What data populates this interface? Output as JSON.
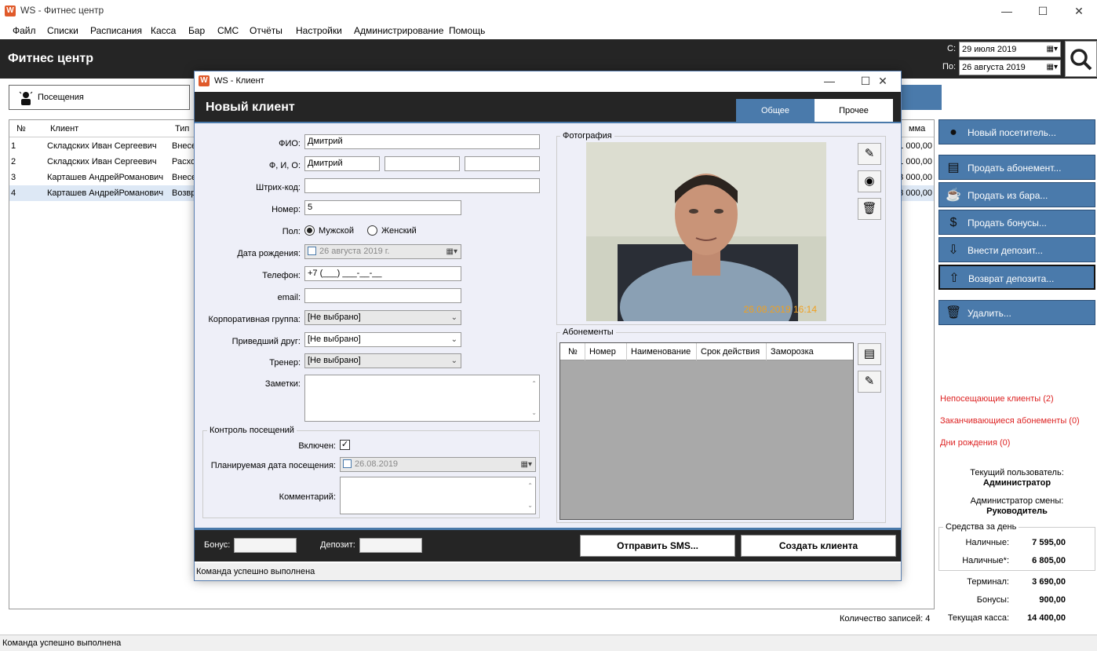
{
  "app": {
    "icon": "W",
    "title": "WS - Фитнес центр",
    "window_controls": {
      "minimize": "—",
      "maximize": "☐",
      "close": "✕"
    }
  },
  "menu": [
    "Файл",
    "Списки",
    "Расписания",
    "Касса",
    "Бар",
    "СМС",
    "Отчёты",
    "Настройки",
    "Администрирование",
    "Помощь"
  ],
  "header": {
    "title": "Фитнес центр",
    "from_label": "С:",
    "from_date": "29    июля      2019",
    "to_label": "По:",
    "to_date": "26  августа    2019"
  },
  "visits_button": "Посещения",
  "table": {
    "headers": [
      "№",
      "Клиент",
      "Тип",
      "мма"
    ],
    "rows": [
      {
        "n": "1",
        "client": "Складских Иван Сергеевич",
        "type": "Внесе",
        "sum": "1 000,00"
      },
      {
        "n": "2",
        "client": "Складских Иван Сергеевич",
        "type": "Расхо",
        "sum": "1 000,00"
      },
      {
        "n": "3",
        "client": "Карташев АндрейРоманович",
        "type": "Внесе",
        "sum": "3 000,00"
      },
      {
        "n": "4",
        "client": "Карташев АндрейРоманович",
        "type": "Возвр",
        "sum": "3 000,00"
      }
    ]
  },
  "right_buttons": [
    "Новый посетитель...",
    "Продать абонемент...",
    "Продать из бара...",
    "Продать бонусы...",
    "Внести депозит...",
    "Возврат депозита...",
    "Удалить..."
  ],
  "links": [
    "Непосещающие клиенты (2)",
    "Заканчивающиеся абонементы (0)",
    "Дни рождения (0)"
  ],
  "user": {
    "current_label": "Текущий пользователь:",
    "current": "Администратор",
    "shift_label": "Администратор смены:",
    "shift": "Руководитель"
  },
  "funds": {
    "title": "Средства за день",
    "cash_label": "Наличные:",
    "cash": "7 595,00",
    "cash2_label": "Наличные*:",
    "cash2": "6 805,00",
    "terminal_label": "Терминал:",
    "terminal": "3 690,00",
    "bonus_label": "Бонусы:",
    "bonus": "900,00",
    "kassa_label": "Текущая касса:",
    "kassa": "14 400,00"
  },
  "records": "Количество записей: 4",
  "status": "Команда успешно выполнена",
  "modal": {
    "title": "WS - Клиент",
    "heading": "Новый клиент",
    "tabs": [
      "Общее",
      "Прочее"
    ],
    "fio_label": "ФИО:",
    "fio": "Дмитрий",
    "fio_parts_label": "Ф, И, О:",
    "surname": "Дмитрий",
    "name": "",
    "patronymic": "",
    "barcode_label": "Штрих-код:",
    "barcode": "",
    "number_label": "Номер:",
    "number": "5",
    "gender_label": "Пол:",
    "male": "Мужской",
    "female": "Женский",
    "birth_label": "Дата рождения:",
    "birth": "26  августа  2019 г.",
    "phone_label": "Телефон:",
    "phone": "+7 (___) ___-__-__",
    "email_label": "email:",
    "email": "",
    "corp_label": "Корпоративная группа:",
    "corp": "[Не выбрано]",
    "friend_label": "Приведший друг:",
    "friend": "[Не выбрано]",
    "trainer_label": "Тренер:",
    "trainer": "[Не выбрано]",
    "notes_label": "Заметки:",
    "control_title": "Контроль посещений",
    "enabled_label": "Включен:",
    "check": "✓",
    "planned_label": "Планируемая дата посещения:",
    "planned": "26.08.2019",
    "comment_label": "Комментарий:",
    "photo_title": "Фотография",
    "photo_timestamp": "26.08.2019 16:14",
    "subs_title": "Абонементы",
    "subs_headers": [
      "№",
      "Номер",
      "Наименование",
      "Срок действия",
      "Заморозка"
    ],
    "bonus_label": "Бонус:",
    "deposit_label": "Депозит:",
    "sms_button": "Отправить SMS...",
    "create_button": "Создать клиента",
    "status": "Команда успешно выполнена"
  }
}
